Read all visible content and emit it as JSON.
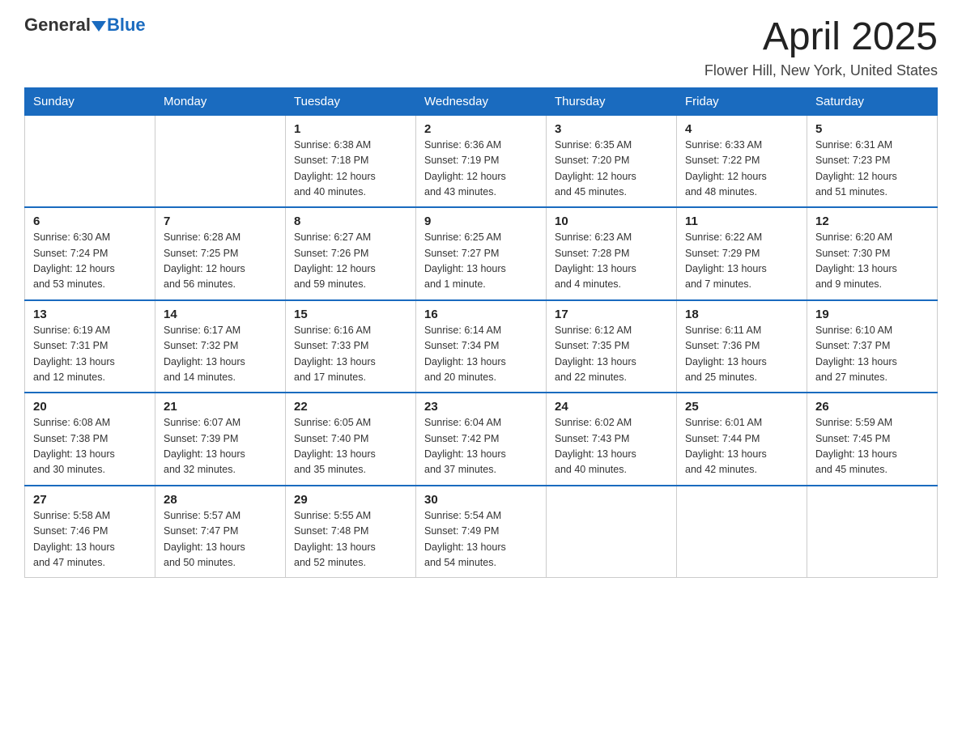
{
  "logo": {
    "general": "General",
    "blue": "Blue"
  },
  "title": "April 2025",
  "subtitle": "Flower Hill, New York, United States",
  "days_of_week": [
    "Sunday",
    "Monday",
    "Tuesday",
    "Wednesday",
    "Thursday",
    "Friday",
    "Saturday"
  ],
  "weeks": [
    [
      {
        "day": "",
        "info": ""
      },
      {
        "day": "",
        "info": ""
      },
      {
        "day": "1",
        "info": "Sunrise: 6:38 AM\nSunset: 7:18 PM\nDaylight: 12 hours\nand 40 minutes."
      },
      {
        "day": "2",
        "info": "Sunrise: 6:36 AM\nSunset: 7:19 PM\nDaylight: 12 hours\nand 43 minutes."
      },
      {
        "day": "3",
        "info": "Sunrise: 6:35 AM\nSunset: 7:20 PM\nDaylight: 12 hours\nand 45 minutes."
      },
      {
        "day": "4",
        "info": "Sunrise: 6:33 AM\nSunset: 7:22 PM\nDaylight: 12 hours\nand 48 minutes."
      },
      {
        "day": "5",
        "info": "Sunrise: 6:31 AM\nSunset: 7:23 PM\nDaylight: 12 hours\nand 51 minutes."
      }
    ],
    [
      {
        "day": "6",
        "info": "Sunrise: 6:30 AM\nSunset: 7:24 PM\nDaylight: 12 hours\nand 53 minutes."
      },
      {
        "day": "7",
        "info": "Sunrise: 6:28 AM\nSunset: 7:25 PM\nDaylight: 12 hours\nand 56 minutes."
      },
      {
        "day": "8",
        "info": "Sunrise: 6:27 AM\nSunset: 7:26 PM\nDaylight: 12 hours\nand 59 minutes."
      },
      {
        "day": "9",
        "info": "Sunrise: 6:25 AM\nSunset: 7:27 PM\nDaylight: 13 hours\nand 1 minute."
      },
      {
        "day": "10",
        "info": "Sunrise: 6:23 AM\nSunset: 7:28 PM\nDaylight: 13 hours\nand 4 minutes."
      },
      {
        "day": "11",
        "info": "Sunrise: 6:22 AM\nSunset: 7:29 PM\nDaylight: 13 hours\nand 7 minutes."
      },
      {
        "day": "12",
        "info": "Sunrise: 6:20 AM\nSunset: 7:30 PM\nDaylight: 13 hours\nand 9 minutes."
      }
    ],
    [
      {
        "day": "13",
        "info": "Sunrise: 6:19 AM\nSunset: 7:31 PM\nDaylight: 13 hours\nand 12 minutes."
      },
      {
        "day": "14",
        "info": "Sunrise: 6:17 AM\nSunset: 7:32 PM\nDaylight: 13 hours\nand 14 minutes."
      },
      {
        "day": "15",
        "info": "Sunrise: 6:16 AM\nSunset: 7:33 PM\nDaylight: 13 hours\nand 17 minutes."
      },
      {
        "day": "16",
        "info": "Sunrise: 6:14 AM\nSunset: 7:34 PM\nDaylight: 13 hours\nand 20 minutes."
      },
      {
        "day": "17",
        "info": "Sunrise: 6:12 AM\nSunset: 7:35 PM\nDaylight: 13 hours\nand 22 minutes."
      },
      {
        "day": "18",
        "info": "Sunrise: 6:11 AM\nSunset: 7:36 PM\nDaylight: 13 hours\nand 25 minutes."
      },
      {
        "day": "19",
        "info": "Sunrise: 6:10 AM\nSunset: 7:37 PM\nDaylight: 13 hours\nand 27 minutes."
      }
    ],
    [
      {
        "day": "20",
        "info": "Sunrise: 6:08 AM\nSunset: 7:38 PM\nDaylight: 13 hours\nand 30 minutes."
      },
      {
        "day": "21",
        "info": "Sunrise: 6:07 AM\nSunset: 7:39 PM\nDaylight: 13 hours\nand 32 minutes."
      },
      {
        "day": "22",
        "info": "Sunrise: 6:05 AM\nSunset: 7:40 PM\nDaylight: 13 hours\nand 35 minutes."
      },
      {
        "day": "23",
        "info": "Sunrise: 6:04 AM\nSunset: 7:42 PM\nDaylight: 13 hours\nand 37 minutes."
      },
      {
        "day": "24",
        "info": "Sunrise: 6:02 AM\nSunset: 7:43 PM\nDaylight: 13 hours\nand 40 minutes."
      },
      {
        "day": "25",
        "info": "Sunrise: 6:01 AM\nSunset: 7:44 PM\nDaylight: 13 hours\nand 42 minutes."
      },
      {
        "day": "26",
        "info": "Sunrise: 5:59 AM\nSunset: 7:45 PM\nDaylight: 13 hours\nand 45 minutes."
      }
    ],
    [
      {
        "day": "27",
        "info": "Sunrise: 5:58 AM\nSunset: 7:46 PM\nDaylight: 13 hours\nand 47 minutes."
      },
      {
        "day": "28",
        "info": "Sunrise: 5:57 AM\nSunset: 7:47 PM\nDaylight: 13 hours\nand 50 minutes."
      },
      {
        "day": "29",
        "info": "Sunrise: 5:55 AM\nSunset: 7:48 PM\nDaylight: 13 hours\nand 52 minutes."
      },
      {
        "day": "30",
        "info": "Sunrise: 5:54 AM\nSunset: 7:49 PM\nDaylight: 13 hours\nand 54 minutes."
      },
      {
        "day": "",
        "info": ""
      },
      {
        "day": "",
        "info": ""
      },
      {
        "day": "",
        "info": ""
      }
    ]
  ]
}
